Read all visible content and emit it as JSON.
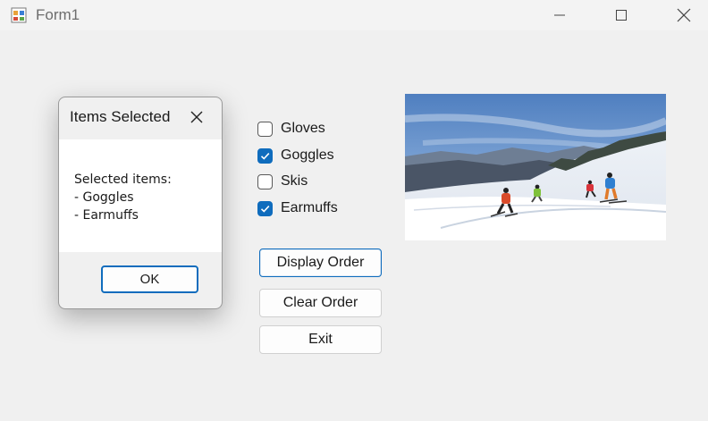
{
  "window": {
    "title": "Form1",
    "icon": "form-app-icon",
    "controls": [
      "minimize-icon",
      "maximize-icon",
      "close-icon"
    ]
  },
  "checkboxes": [
    {
      "label": "Gloves",
      "checked": false
    },
    {
      "label": "Goggles",
      "checked": true
    },
    {
      "label": "Skis",
      "checked": false
    },
    {
      "label": "Earmuffs",
      "checked": true
    }
  ],
  "buttons": {
    "display": "Display Order",
    "clear": "Clear Order",
    "exit": "Exit"
  },
  "image": {
    "subject": "skiers on a snowy slope",
    "icon": "ski-photo"
  },
  "dialog": {
    "title": "Items Selected",
    "message": "Selected items:\n- Goggles\n- Earmuffs",
    "ok": "OK"
  },
  "colors": {
    "accent": "#0f6cbd",
    "background": "#f0f0f0"
  }
}
